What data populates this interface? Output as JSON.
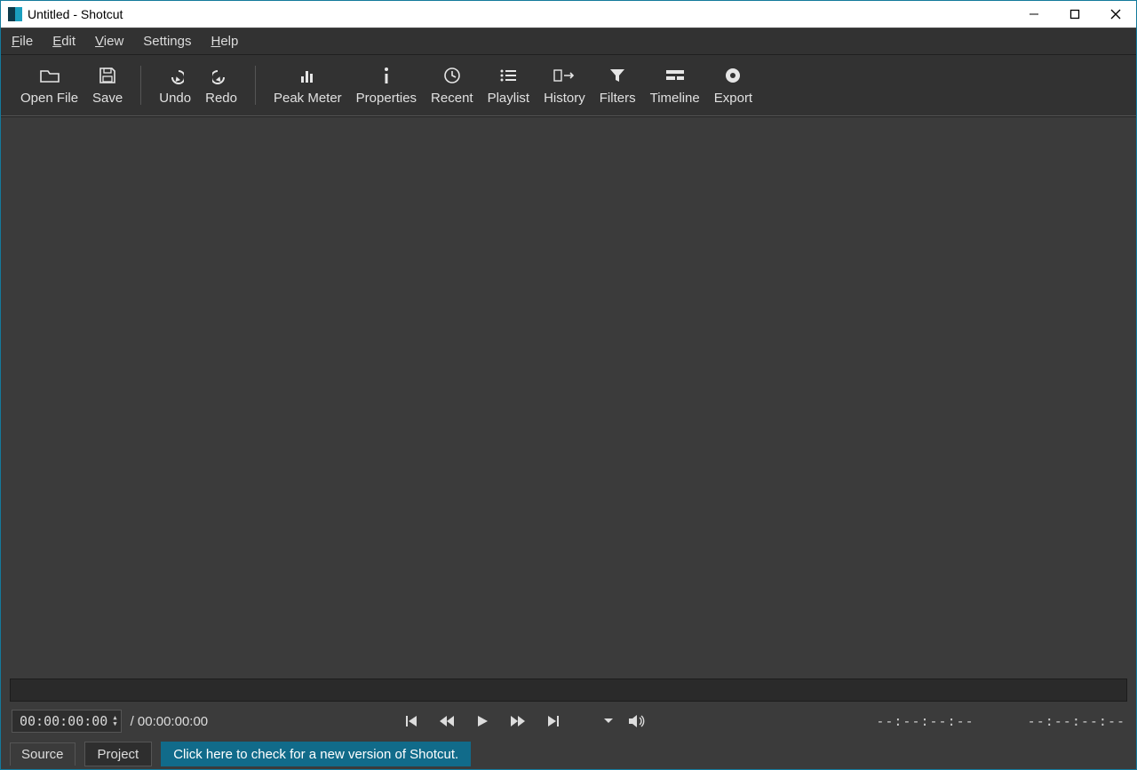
{
  "window": {
    "title": "Untitled - Shotcut"
  },
  "menu": {
    "file": "File",
    "edit": "Edit",
    "view": "View",
    "settings": "Settings",
    "help": "Help"
  },
  "toolbar": {
    "open_file": "Open File",
    "save": "Save",
    "undo": "Undo",
    "redo": "Redo",
    "peak_meter": "Peak Meter",
    "properties": "Properties",
    "recent": "Recent",
    "playlist": "Playlist",
    "history": "History",
    "filters": "Filters",
    "timeline": "Timeline",
    "export": "Export"
  },
  "transport": {
    "current": "00:00:00:00",
    "total": "/ 00:00:00:00",
    "in_point": "--:--:--:--",
    "out_point": "--:--:--:--"
  },
  "tabs": {
    "source": "Source",
    "project": "Project"
  },
  "notice": "Click here to check for a new version of Shotcut."
}
